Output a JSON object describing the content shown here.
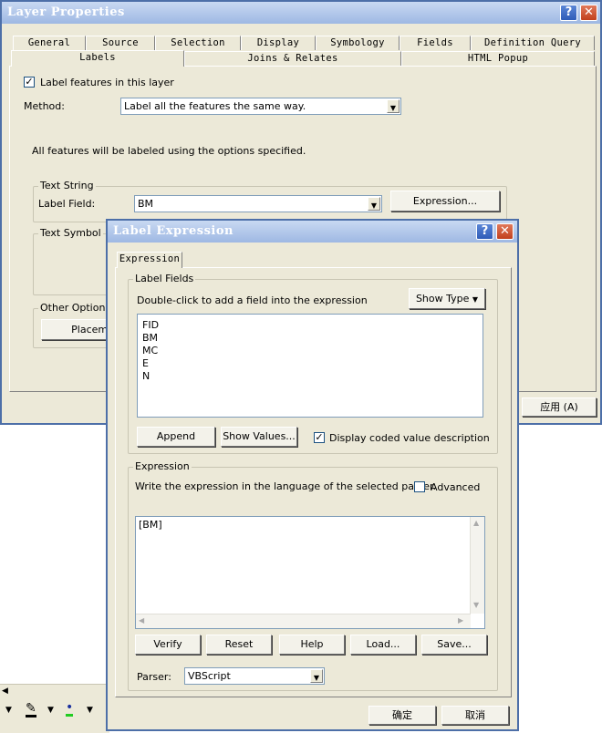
{
  "layer_props": {
    "title": "Layer Properties",
    "tabs_row1": [
      "General",
      "Source",
      "Selection",
      "Display",
      "Symbology",
      "Fields",
      "Definition Query"
    ],
    "tabs_row2": [
      "Labels",
      "Joins & Relates",
      "HTML Popup"
    ],
    "label_features_label": "Label features in this layer",
    "method_label": "Method:",
    "method_value": "Label all the features the same way.",
    "info_text": "All features will be labeled using the options specified.",
    "text_string_group": "Text String",
    "label_field_label": "Label Field:",
    "label_field_value": "BM",
    "expression_button": "Expression...",
    "text_symbol_group": "Text Symbol",
    "other_options_group": "Other Options",
    "placement_button": "Placemen",
    "apply_button": "应用 (A)"
  },
  "label_expr": {
    "title": "Label Expression",
    "tab": "Expression",
    "label_fields_group": "Label Fields",
    "fields_hint": "Double-click to add a field into the expression",
    "show_type_button": "Show Type",
    "fields": [
      "FID",
      "BM",
      "MC",
      "E",
      "N"
    ],
    "append_button": "Append",
    "show_values_button": "Show Values...",
    "display_coded_label": "Display coded value description",
    "expression_group": "Expression",
    "expression_hint": "Write the expression in the language of the selected parser.",
    "advanced_label": "Advanced",
    "expression_text": "[BM]",
    "verify_button": "Verify",
    "reset_button": "Reset",
    "help_button": "Help",
    "load_button": "Load...",
    "save_button": "Save...",
    "parser_label": "Parser:",
    "parser_value": "VBScript",
    "ok_button": "确定",
    "cancel_button": "取消"
  },
  "icons": [
    "help-icon",
    "close-icon",
    "dropdown-arrow-icon",
    "pen-icon",
    "point-color-icon"
  ]
}
